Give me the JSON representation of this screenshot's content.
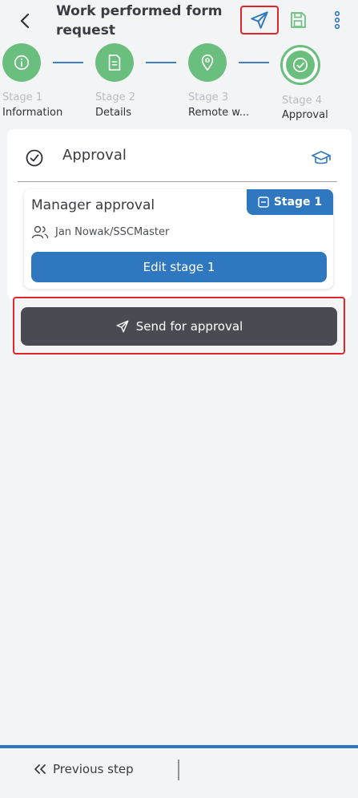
{
  "header": {
    "title": "Work performed form request",
    "icons": {
      "back": "chevron-left-icon",
      "send": "send-icon",
      "save": "save-icon",
      "more": "more-vertical-icon"
    }
  },
  "stepper": {
    "steps": [
      {
        "number": "Stage 1",
        "name": "Information",
        "icon": "info-icon",
        "status": "done"
      },
      {
        "number": "Stage 2",
        "name": "Details",
        "icon": "document-icon",
        "status": "done"
      },
      {
        "number": "Stage 3",
        "name": "Remote w...",
        "icon": "location-icon",
        "status": "done"
      },
      {
        "number": "Stage 4",
        "name": "Approval",
        "icon": "check-circle-icon",
        "status": "active"
      }
    ]
  },
  "approval": {
    "title": "Approval",
    "card": {
      "title": "Manager approval",
      "badge": "Stage 1",
      "approver": "Jan Nowak/SSCMaster",
      "edit_label": "Edit stage 1"
    },
    "send_label": "Send for approval"
  },
  "footer": {
    "previous_label": "Previous step"
  },
  "colors": {
    "accent": "#2f78c0",
    "success": "#6bbf7e",
    "dark_button": "#4a4b52",
    "highlight": "#e0262b"
  }
}
